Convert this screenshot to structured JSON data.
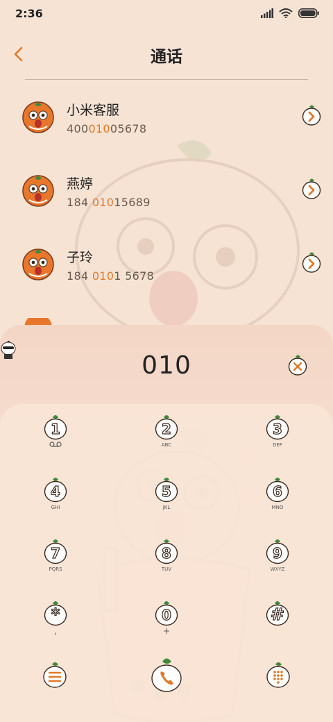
{
  "status_bar": {
    "time": "2:36"
  },
  "header": {
    "title": "通话"
  },
  "contacts": [
    {
      "name": "小米客服",
      "number_pre": "400",
      "number_match": "010",
      "number_post": "05678"
    },
    {
      "name": "燕婷",
      "number_pre": "184 ",
      "number_match": "010",
      "number_post": "15689"
    },
    {
      "name": "子玲",
      "number_pre": "184 ",
      "number_match": "010",
      "number_post": "1 5678"
    }
  ],
  "dialer": {
    "input": "010",
    "keys": [
      {
        "digit": "1",
        "letters": ""
      },
      {
        "digit": "2",
        "letters": "ABC"
      },
      {
        "digit": "3",
        "letters": "DEF"
      },
      {
        "digit": "4",
        "letters": "GHI"
      },
      {
        "digit": "5",
        "letters": "JKL"
      },
      {
        "digit": "6",
        "letters": "MNO"
      },
      {
        "digit": "7",
        "letters": "PQRS"
      },
      {
        "digit": "8",
        "letters": "TUV"
      },
      {
        "digit": "9",
        "letters": "WXYZ"
      },
      {
        "digit": "*",
        "letters": ","
      },
      {
        "digit": "0",
        "letters": "+"
      },
      {
        "digit": "#",
        "letters": ""
      }
    ]
  },
  "colors": {
    "accent": "#e07a2c",
    "background": "#f6e3d4",
    "leaf": "#3f8a3a"
  }
}
